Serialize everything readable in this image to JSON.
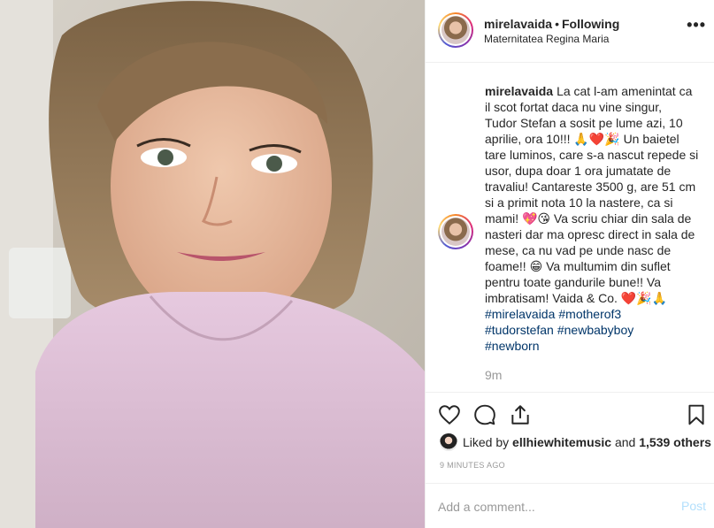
{
  "post": {
    "username": "mirelavaida",
    "separator": "•",
    "follow_status": "Following",
    "location": "Maternitatea Regina Maria",
    "more_label": "•••"
  },
  "caption": {
    "username": "mirelavaida",
    "lines": [
      "La cat l-am amenintat ca",
      "il scot fortat daca nu vine singur,",
      "Tudor Stefan a sosit pe lume azi, 10",
      "aprilie, ora 10!!! 🙏❤️🎉 Un baietel",
      "tare luminos, care s-a nascut repede si",
      "usor, dupa doar 1 ora jumatate de",
      "travaliu! Cantareste 3500 g, are 51 cm",
      "si a primit nota 10 la nastere, ca si",
      "mami! 💖😘 Va scriu chiar din sala de",
      "nasteri dar ma opresc direct in sala de",
      "mese, ca nu vad pe unde nasc de",
      "foame!! 😁 Va multumim din suflet",
      "pentru toate gandurile bune!! Va",
      "imbratisam! Vaida & Co. ❤️🎉🙏"
    ],
    "hashtags": [
      [
        "#mirelavaida",
        "#motherof3"
      ],
      [
        "#tudorstefan",
        "#newbabyboy"
      ],
      [
        "#newborn"
      ]
    ],
    "time_ago": "9m"
  },
  "actions": {
    "like_icon": "heart-icon",
    "comment_icon": "comment-icon",
    "share_icon": "share-icon",
    "save_icon": "bookmark-icon"
  },
  "likes": {
    "prefix": "Liked by",
    "user": "ellhiewhitemusic",
    "conjunction": "and",
    "others": "1,539 others"
  },
  "posted_ago": "9 MINUTES AGO",
  "comment": {
    "placeholder": "Add a comment...",
    "post_label": "Post"
  },
  "colors": {
    "text": "#262626",
    "muted": "#999999",
    "hashtag": "#003569",
    "post_button_disabled": "#b2dffc",
    "border": "#efefef"
  }
}
